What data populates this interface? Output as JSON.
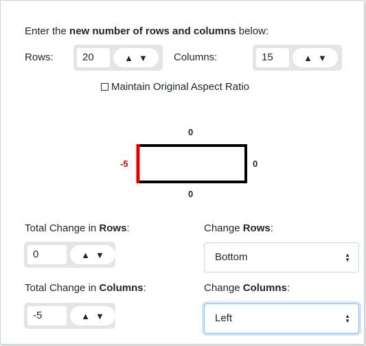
{
  "intro": {
    "prefix": "Enter the ",
    "bold": "new number of rows and columns",
    "suffix": " below:"
  },
  "rows": {
    "label": "Rows:",
    "value": "20"
  },
  "columns": {
    "label": "Columns:",
    "value": "15"
  },
  "aspect": {
    "label": "Maintain Original Aspect Ratio",
    "checked": false
  },
  "diagram": {
    "top": "0",
    "left": "-5",
    "right": "0",
    "bottom": "0",
    "highlight_color": "#e00000"
  },
  "total_rows": {
    "prefix": "Total Change in ",
    "bold": "Rows",
    "suffix": ":",
    "value": "0"
  },
  "total_cols": {
    "prefix": "Total Change in ",
    "bold": "Columns",
    "suffix": ":",
    "value": "-5"
  },
  "change_rows": {
    "prefix": "Change ",
    "bold": "Rows",
    "suffix": ":",
    "selected": "Bottom"
  },
  "change_cols": {
    "prefix": "Change ",
    "bold": "Columns",
    "suffix": ":",
    "selected": "Left"
  },
  "icons": {
    "stepper": "up-down-triangles",
    "select_caret": "up-down-caret"
  }
}
